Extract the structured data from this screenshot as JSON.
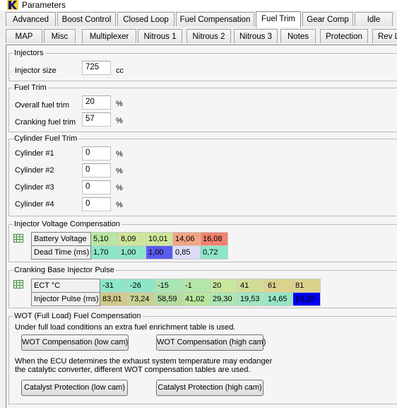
{
  "window": {
    "title": "Parameters"
  },
  "tabs_row1": [
    "Advanced",
    "Boost Control",
    "Closed Loop",
    "Fuel Compensation",
    "Fuel Trim",
    "Gear Comp",
    "Idle"
  ],
  "tabs_row2": [
    "MAP",
    "Misc",
    "Multiplexer",
    "Nitrous 1",
    "Nitrous 2",
    "Nitrous 3",
    "Notes",
    "Protection",
    "Rev L"
  ],
  "active_tab": "Fuel Trim",
  "injectors": {
    "title": "Injectors",
    "injector_size_label": "Injector size",
    "injector_size_value": "725",
    "injector_size_unit": "cc"
  },
  "fuel_trim": {
    "title": "Fuel Trim",
    "overall_label": "Overall fuel trim",
    "overall_value": "20",
    "cranking_label": "Cranking fuel trim",
    "cranking_value": "57",
    "unit": "%"
  },
  "cylinder_trim": {
    "title": "Cylinder Fuel Trim",
    "cylinders": [
      {
        "label": "Cylinder #1",
        "value": "0"
      },
      {
        "label": "Cylinder #2",
        "value": "0"
      },
      {
        "label": "Cylinder #3",
        "value": "0"
      },
      {
        "label": "Cylinder #4",
        "value": "0"
      }
    ],
    "unit": "%"
  },
  "voltage_comp": {
    "title": "Injector Voltage Compensation",
    "rows": [
      {
        "header": "Battery Voltage",
        "cells": [
          "5,10",
          "8,09",
          "10,01",
          "14,06",
          "16,08"
        ],
        "colors": [
          "#b9e6a0",
          "#cfe69a",
          "#cfe69a",
          "#f0a582",
          "#f0826e"
        ]
      },
      {
        "header": "Dead Time (ms)",
        "cells": [
          "1,70",
          "1,00",
          "1,00",
          "0,85",
          "0,72"
        ],
        "colors": [
          "#8ee6c8",
          "#8ee6c8",
          "#5a5aee",
          "#dcdcf8",
          "#8ee6c8"
        ]
      }
    ]
  },
  "cranking_pulse": {
    "title": "Cranking Base Injector Pulse",
    "rows": [
      {
        "header": "ECT °C",
        "cells": [
          "-31",
          "-26",
          "-15",
          "-1",
          "20",
          "41",
          "61",
          "81"
        ],
        "colors": [
          "#8ee6c8",
          "#8ee6c8",
          "#a8e6b4",
          "#b4e6a8",
          "#c8e69c",
          "#d2dc96",
          "#dcd28c",
          "#dcd28c"
        ]
      },
      {
        "header": "Injector Pulse (ms)",
        "cells": [
          "83,01",
          "73,24",
          "58,59",
          "41,02",
          "29,30",
          "19,53",
          "14,65",
          "10,25"
        ],
        "colors": [
          "#d2c88c",
          "#c8d296",
          "#b4dca0",
          "#b9e6a0",
          "#aee6b4",
          "#a0e6c0",
          "#96e6c4",
          "#0000ee"
        ]
      }
    ]
  },
  "wot": {
    "title": "WOT (Full Load) Fuel Compensation",
    "desc1": "Under full load conditions an extra fuel enrichment table is used.",
    "btn_low": "WOT Compensation (low cam)",
    "btn_high": "WOT Compensation (high cam)",
    "desc2_line1": "When the ECU determines the exhaust system temperature may endanger",
    "desc2_line2": "the catalytic converter, different WOT compensation tables are used.",
    "cat_low": "Catalyst Protection (low cam)",
    "cat_high": "Catalyst Protection (high cam)"
  }
}
